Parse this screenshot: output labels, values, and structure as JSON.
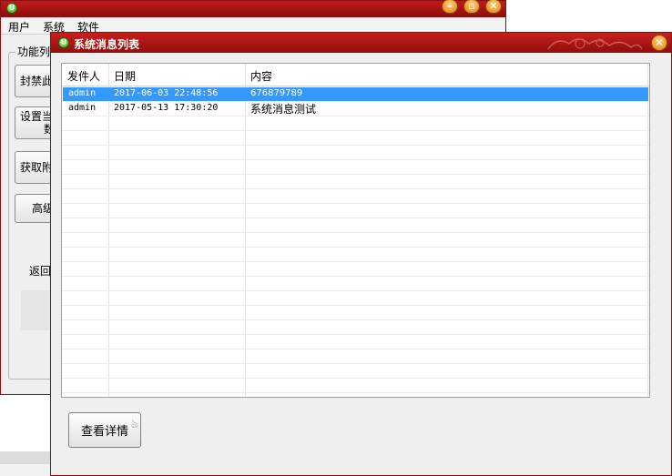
{
  "background_window": {
    "menu": [
      "用户",
      "系统",
      "软件"
    ],
    "group_label": "功能列",
    "buttons": [
      {
        "line1": "封禁此"
      },
      {
        "line1": "设置当",
        "line2": "数"
      },
      {
        "line1": "获取附"
      },
      {
        "line1": "高级"
      }
    ],
    "return_label": "返回"
  },
  "dialog": {
    "title": "系统消息列表",
    "close_glyph": "✕",
    "columns": [
      "发件人",
      "日期",
      "内容"
    ],
    "rows": [
      {
        "sender": "admin",
        "date": "2017-06-03 22:48:56",
        "content": "676879789",
        "selected": true
      },
      {
        "sender": "admin",
        "date": "2017-05-13 17:30:20",
        "content": "系统消息测试",
        "selected": false
      }
    ],
    "detail_button": "查看详情"
  },
  "colors": {
    "titlebar": "#a81414",
    "selection": "#3399ff",
    "window_bg": "#efefef"
  },
  "icons": [
    "app-icon",
    "minimize-icon",
    "maximize-icon",
    "close-icon"
  ]
}
